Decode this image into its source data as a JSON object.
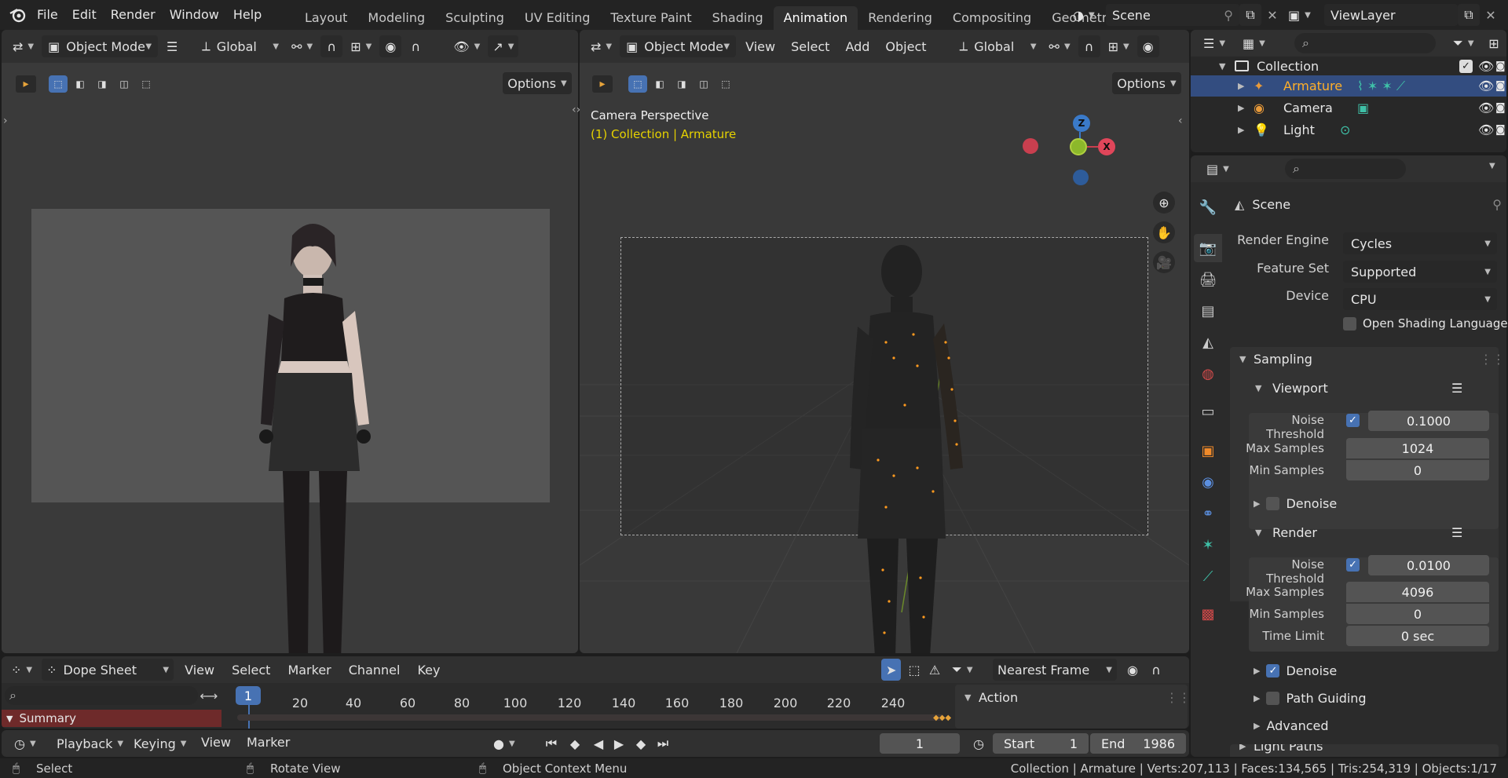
{
  "menu": [
    "File",
    "Edit",
    "Render",
    "Window",
    "Help"
  ],
  "workspaces": [
    "Layout",
    "Modeling",
    "Sculpting",
    "UV Editing",
    "Texture Paint",
    "Shading",
    "Animation",
    "Rendering",
    "Compositing",
    "Geometry Node"
  ],
  "active_workspace": "Animation",
  "scene_name": "Scene",
  "view_layer": "ViewLayer",
  "left_view": {
    "mode": "Object Mode",
    "orientation": "Global",
    "options": "Options"
  },
  "right_view": {
    "mode": "Object Mode",
    "menus": [
      "View",
      "Select",
      "Add",
      "Object"
    ],
    "orientation": "Global",
    "options": "Options",
    "overlay_title": "Camera Perspective",
    "overlay_sub": "(1) Collection | Armature",
    "gizmo": {
      "z": "Z",
      "x": "X"
    }
  },
  "outliner": {
    "collection": "Collection",
    "items": [
      {
        "name": "Armature",
        "selected": true
      },
      {
        "name": "Camera",
        "selected": false
      },
      {
        "name": "Light",
        "selected": false
      }
    ]
  },
  "properties": {
    "context": "Scene",
    "render_engine_label": "Render Engine",
    "render_engine": "Cycles",
    "feature_set_label": "Feature Set",
    "feature_set": "Supported",
    "device_label": "Device",
    "device": "CPU",
    "osl_label": "Open Shading Language",
    "sampling": "Sampling",
    "viewport": "Viewport",
    "noise_threshold_label": "Noise Threshold",
    "vp_noise": "0.1000",
    "max_samples_label": "Max Samples",
    "vp_max": "1024",
    "min_samples_label": "Min Samples",
    "vp_min": "0",
    "denoise": "Denoise",
    "render": "Render",
    "r_noise": "0.0100",
    "r_max": "4096",
    "r_min": "0",
    "time_limit_label": "Time Limit",
    "time_limit": "0 sec",
    "path_guiding": "Path Guiding",
    "advanced": "Advanced",
    "light_paths": "Light Paths"
  },
  "dopesheet": {
    "mode": "Dope Sheet",
    "menus": [
      "View",
      "Select",
      "Marker",
      "Channel",
      "Key"
    ],
    "snap": "Nearest Frame",
    "current_frame_label": "1",
    "ticks": [
      "20",
      "40",
      "60",
      "80",
      "100",
      "120",
      "140",
      "160",
      "180",
      "200",
      "220",
      "240"
    ],
    "summary": "Summary",
    "action": "Action"
  },
  "timeline": {
    "menus": [
      "Playback",
      "Keying",
      "View",
      "Marker"
    ],
    "frame": "1",
    "start_label": "Start",
    "start": "1",
    "end_label": "End",
    "end": "1986"
  },
  "status": {
    "select": "Select",
    "rotate": "Rotate View",
    "context": "Object Context Menu",
    "stats": "Collection | Armature | Verts:207,113 | Faces:134,565 | Tris:254,319 | Objects:1/17"
  },
  "colors": {
    "accent": "#4772b3",
    "selected_text": "#ffaf29",
    "overlay_sub": "#e6d200",
    "summary_bg": "#6e2a2a"
  }
}
